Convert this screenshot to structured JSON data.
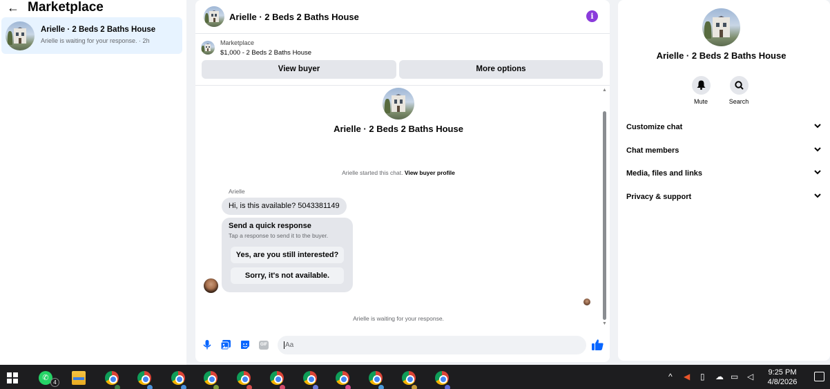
{
  "left": {
    "back_icon": "arrow-left-icon",
    "title": "Marketplace",
    "conversation": {
      "name": "Arielle · 2 Beds 2 Baths House",
      "subtitle": "Arielle is waiting for your response. · 2h"
    }
  },
  "chat": {
    "header_name": "Arielle · 2 Beds 2 Baths House",
    "info_icon": "i",
    "listing_label": "Marketplace",
    "listing_price": "$1,000 - 2 Beds 2 Baths House",
    "view_buyer": "View buyer",
    "more_options": "More options",
    "big_name": "Arielle · 2 Beds 2 Baths House",
    "started_text": "Arielle started this chat.",
    "view_profile": "View buyer profile",
    "sender": "Arielle",
    "message": "Hi, is this available? 5043381149",
    "quick_title": "Send a quick response",
    "quick_sub": "Tap a response to send it to the buyer.",
    "quick_options": [
      "Yes, are you still interested?",
      "Sorry, it's not available."
    ],
    "waiting": "Arielle is waiting for your response.",
    "composer_placeholder": "Aa",
    "gif_label": "GIF"
  },
  "right": {
    "name": "Arielle · 2 Beds 2 Baths House",
    "mute_label": "Mute",
    "search_label": "Search",
    "sections": [
      "Customize chat",
      "Chat members",
      "Media, files and links",
      "Privacy & support"
    ]
  },
  "taskbar": {
    "whatsapp_badge": "4",
    "time": "9:25 PM",
    "date": "4/8/2026",
    "chrome_profile_colors": [
      "#3a7d44",
      "#4a90d9",
      "#4a90d9",
      "#7a9a3a",
      "#d44a4a",
      "#d44a6a",
      "#6a7ad9",
      "#d44a8a",
      "#4a9ad9",
      "#c49a3a",
      "#5a6ad9"
    ]
  },
  "colors": {
    "accent": "#0866ff",
    "info": "#8a3bdb",
    "selected": "#e7f3ff"
  }
}
